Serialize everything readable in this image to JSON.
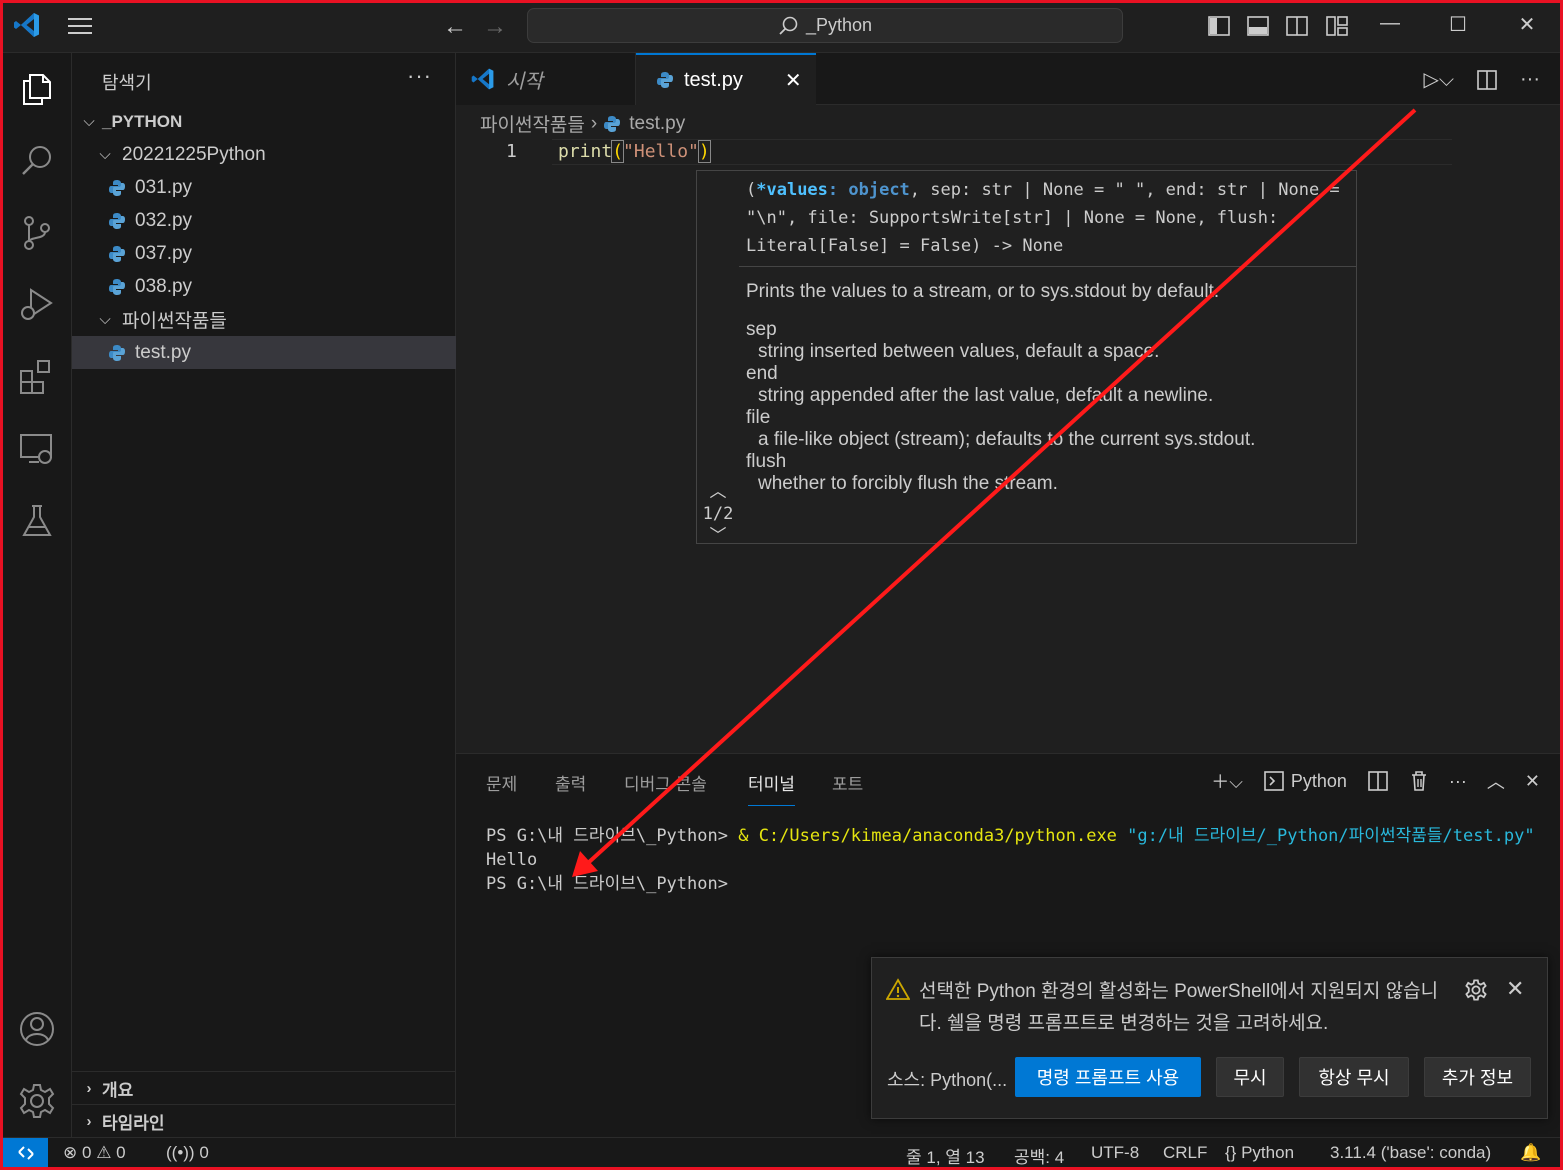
{
  "titlebar": {
    "search_text": "_Python"
  },
  "sidebar": {
    "title": "탐색기",
    "more": "···",
    "root": "_PYTHON",
    "folder1": "20221225Python",
    "files1": [
      "031.py",
      "032.py",
      "037.py",
      "038.py"
    ],
    "folder2": "파이썬작품들",
    "selected_file": "test.py",
    "outline": "개요",
    "timeline": "타임라인"
  },
  "tabs": {
    "welcome": "시작",
    "active": "test.py"
  },
  "editor": {
    "breadcrumb_folder": "파이썬작품들",
    "breadcrumb_file": "test.py",
    "line_number": "1",
    "code_fn": "print",
    "code_str": "\"Hello\""
  },
  "hover": {
    "nav_count": "1/2",
    "summary": "Prints the values to a stream, or to sys.stdout by default.",
    "params": [
      {
        "name": "sep",
        "desc": "string inserted between values, default a space."
      },
      {
        "name": "end",
        "desc": "string appended after the last value, default a newline."
      },
      {
        "name": "file",
        "desc": "a file-like object (stream); defaults to the current sys.stdout."
      },
      {
        "name": "flush",
        "desc": "whether to forcibly flush the stream."
      }
    ]
  },
  "panel": {
    "tabs": [
      "문제",
      "출력",
      "디버그 콘솔",
      "터미널",
      "포트"
    ],
    "active_tab": "터미널",
    "shell_label": "Python",
    "terminal": {
      "prompt1": "PS G:\\내 드라이브\\_Python> ",
      "amp": "& ",
      "exe": "C:/Users/kimea/anaconda3/python.exe",
      "arg": " \"g:/내 드라이브/_Python/파이썬작품들/test.py\"",
      "output": "Hello",
      "prompt2": "PS G:\\내 드라이브\\_Python>"
    }
  },
  "notification": {
    "message": "선택한 Python 환경의 활성화는 PowerShell에서 지원되지 않습니다. 쉘을 명령 프롬프트로 변경하는 것을 고려하세요.",
    "source": "소스: Python(...",
    "btn_primary": "명령 프롬프트 사용",
    "btn_ignore": "무시",
    "btn_always_ignore": "항상 무시",
    "btn_more": "추가 정보"
  },
  "statusbar": {
    "errors": "0",
    "warnings": "0",
    "ports": "0",
    "position": "줄 1, 열 13",
    "spaces": "공백: 4",
    "encoding": "UTF-8",
    "eol": "CRLF",
    "language": "Python",
    "interpreter": "3.11.4 ('base': conda)"
  },
  "colors": {
    "accent": "#0078d4",
    "annotation_arrow": "#ff1a1a"
  }
}
